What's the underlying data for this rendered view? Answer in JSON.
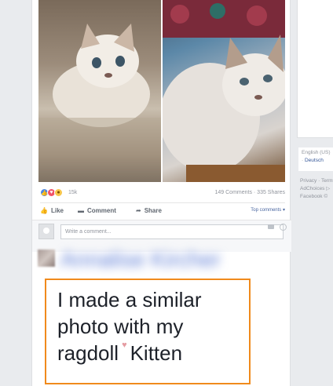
{
  "post": {
    "reactions": {
      "count": "15k",
      "stats": "149 Comments · 335 Shares"
    },
    "actions": {
      "like": "Like",
      "comment": "Comment",
      "share": "Share",
      "sort": "Top comments ▾"
    },
    "comment_input": {
      "placeholder": "Write a comment..."
    }
  },
  "comment": {
    "author_blurred": "Annalise Kircher",
    "text_lines": [
      "I made a similar",
      "photo with my",
      "ragdoll",
      "Kitten"
    ],
    "heart": "♥"
  },
  "sidebar": {
    "language_primary": "English (US)",
    "language_secondary": "Deutsch",
    "footer_lines": [
      "Privacy · Terms",
      "AdChoices ▷",
      "Facebook ©"
    ]
  },
  "colors": {
    "highlight": "#f08a1c",
    "link": "#365899",
    "like": "#4a87e8"
  }
}
